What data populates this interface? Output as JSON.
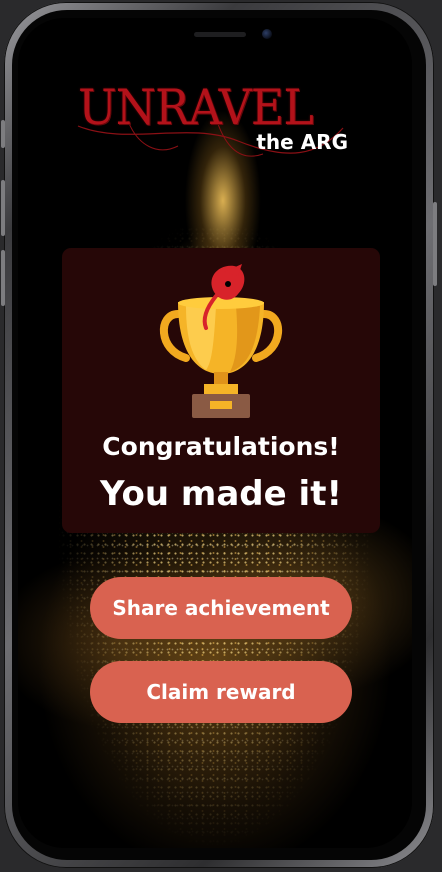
{
  "logo": {
    "title": "UNRAVEL",
    "subtitle": "the ARG"
  },
  "card": {
    "icon": "trophy-icon",
    "congrats": "Congratulations!",
    "message": "You made it!"
  },
  "buttons": {
    "share_label": "Share achievement",
    "claim_label": "Claim reward"
  },
  "colors": {
    "accent": "#d96250",
    "card_bg": "#260707",
    "logo_red": "#b3121a",
    "trophy_gold": "#f5b427"
  }
}
